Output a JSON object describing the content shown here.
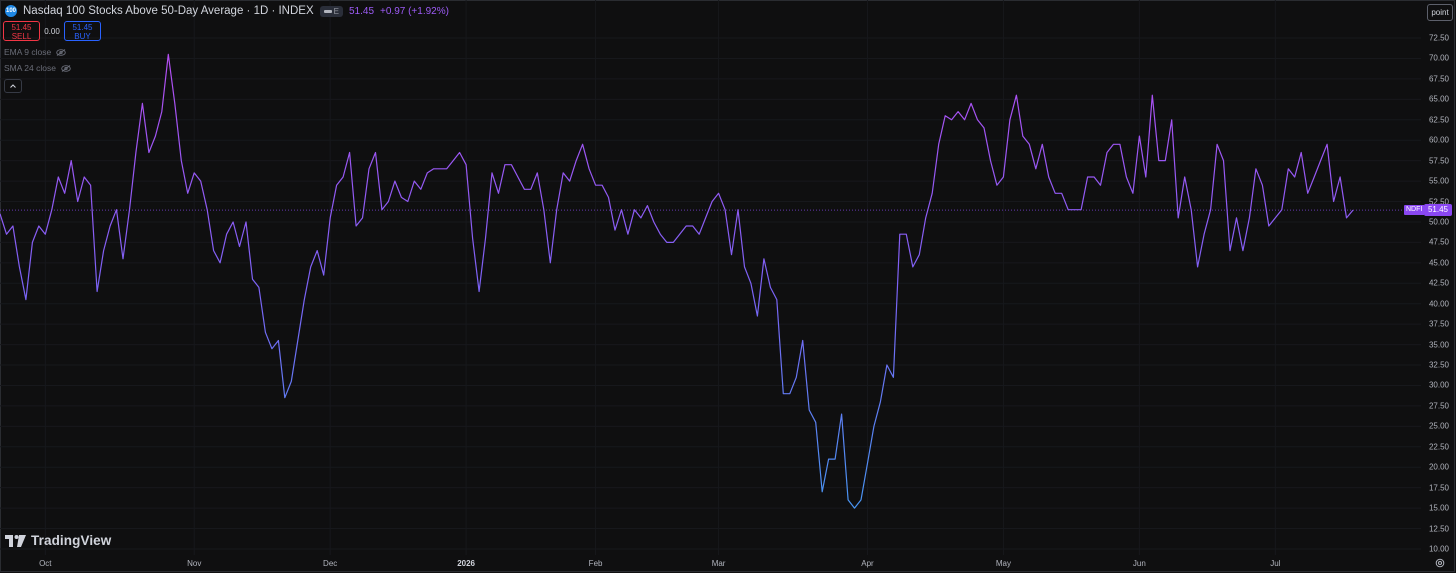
{
  "header": {
    "logo_text": "100",
    "title": "Nasdaq 100 Stocks Above 50-Day Average · 1D · INDEX",
    "pill_label": "E",
    "last": "51.45",
    "change": "+0.97 (+1.92%)"
  },
  "trade": {
    "sell_price": "51.45",
    "sell_label": "SELL",
    "spread": "0.00",
    "buy_price": "51.45",
    "buy_label": "BUY"
  },
  "indicators": [
    {
      "label": "EMA 9 close",
      "icon": "eye-off-icon"
    },
    {
      "label": "SMA 24 close",
      "icon": "eye-off-icon"
    }
  ],
  "price_scale": {
    "mode_label": "point",
    "symbol_tag": "NDFI",
    "last_value": "51.45",
    "ticks": [
      "72.50",
      "70.00",
      "67.50",
      "65.00",
      "62.50",
      "60.00",
      "57.50",
      "55.00",
      "52.50",
      "50.00",
      "47.50",
      "45.00",
      "42.50",
      "40.00",
      "37.50",
      "35.00",
      "32.50",
      "30.00",
      "27.50",
      "25.00",
      "22.50",
      "20.00",
      "17.50",
      "15.00",
      "12.50",
      "10.00"
    ]
  },
  "time_scale": {
    "labels": [
      "Oct",
      "Nov",
      "Dec",
      "2026",
      "Feb",
      "Mar",
      "Apr",
      "May",
      "Jun",
      "Jul"
    ]
  },
  "brand": {
    "name": "TradingView"
  },
  "colors": {
    "background": "#0f0f10",
    "line_high": "#b84cf2",
    "line_mid": "#7a63f5",
    "line_low": "#3e9ef2",
    "last_price": "#8a47f2",
    "sell": "#f23645",
    "buy": "#2962ff"
  },
  "chart_data": {
    "type": "line",
    "title": "Nasdaq 100 Stocks Above 50-Day Average · 1D · INDEX",
    "xlabel": "",
    "ylabel": "",
    "ylim": [
      10,
      72.5
    ],
    "y_tick_step": 2.5,
    "grid": true,
    "x_ticks": [
      {
        "label": "Oct",
        "index": 7
      },
      {
        "label": "Nov",
        "index": 30
      },
      {
        "label": "Dec",
        "index": 51
      },
      {
        "label": "2026",
        "index": 72
      },
      {
        "label": "Feb",
        "index": 92
      },
      {
        "label": "Mar",
        "index": 111
      },
      {
        "label": "Apr",
        "index": 134
      },
      {
        "label": "May",
        "index": 155
      },
      {
        "label": "Jun",
        "index": 176
      },
      {
        "label": "Jul",
        "index": 197
      }
    ],
    "series": [
      {
        "values": [
          51,
          48.5,
          49.5,
          44.5,
          40.5,
          47.5,
          49.5,
          48.5,
          51.5,
          55.5,
          53.5,
          57.5,
          52.5,
          55.5,
          54.5,
          41.5,
          46.5,
          49.5,
          51.5,
          45.5,
          51.5,
          58.5,
          64.5,
          58.5,
          60.5,
          63.5,
          70.5,
          64.5,
          57.5,
          53.5,
          56.0,
          55.0,
          51.5,
          46.5,
          45.0,
          48.5,
          50.0,
          47.0,
          50.0,
          43.0,
          42.0,
          36.5,
          34.5,
          35.5,
          28.5,
          30.5,
          35.5,
          40.5,
          44.5,
          46.5,
          43.5,
          50.5,
          54.5,
          55.5,
          58.5,
          49.5,
          50.5,
          56.5,
          58.5,
          51.5,
          52.5,
          55.0,
          53.0,
          52.5,
          55.0,
          54.0,
          56.0,
          56.5,
          56.5,
          56.5,
          57.5,
          58.5,
          57.0,
          48.0,
          41.5,
          48.0,
          56.0,
          53.5,
          57.0,
          57.0,
          55.5,
          54.0,
          54.0,
          56.0,
          51.5,
          45.0,
          51.5,
          56.0,
          55.0,
          57.5,
          59.5,
          56.5,
          54.5,
          54.5,
          53.0,
          49.0,
          51.5,
          48.5,
          51.5,
          50.5,
          52.0,
          50.0,
          48.5,
          47.5,
          47.5,
          48.5,
          49.5,
          49.5,
          48.5,
          50.5,
          52.5,
          53.5,
          51.5,
          46.0,
          51.5,
          44.5,
          42.5,
          38.5,
          45.5,
          42.0,
          40.5,
          29.0,
          29.0,
          31.0,
          35.5,
          27.0,
          25.5,
          17.0,
          21.0,
          21.0,
          26.5,
          16.0,
          15.0,
          16.0,
          20.5,
          25.0,
          28.0,
          32.5,
          31.0,
          48.5,
          48.5,
          44.5,
          46.0,
          50.5,
          53.5,
          59.5,
          63.0,
          62.5,
          63.5,
          62.5,
          64.5,
          62.5,
          61.5,
          57.5,
          54.5,
          55.5,
          62.5,
          65.5,
          60.5,
          59.5,
          56.5,
          59.5,
          55.5,
          53.5,
          53.5,
          51.5,
          51.5,
          51.5,
          55.5,
          55.5,
          54.5,
          58.5,
          59.5,
          59.5,
          55.5,
          53.5,
          60.5,
          55.5,
          65.5,
          57.5,
          57.5,
          62.5,
          50.5,
          55.5,
          51.5,
          44.5,
          48.5,
          51.5,
          59.5,
          57.5,
          46.5,
          50.5,
          46.5,
          50.5,
          56.5,
          54.5,
          49.5,
          50.5,
          51.5,
          56.5,
          55.5,
          58.5,
          53.5,
          55.5,
          57.5,
          59.5,
          52.5,
          55.5,
          50.5,
          51.45
        ]
      }
    ],
    "last_value": 51.45
  }
}
